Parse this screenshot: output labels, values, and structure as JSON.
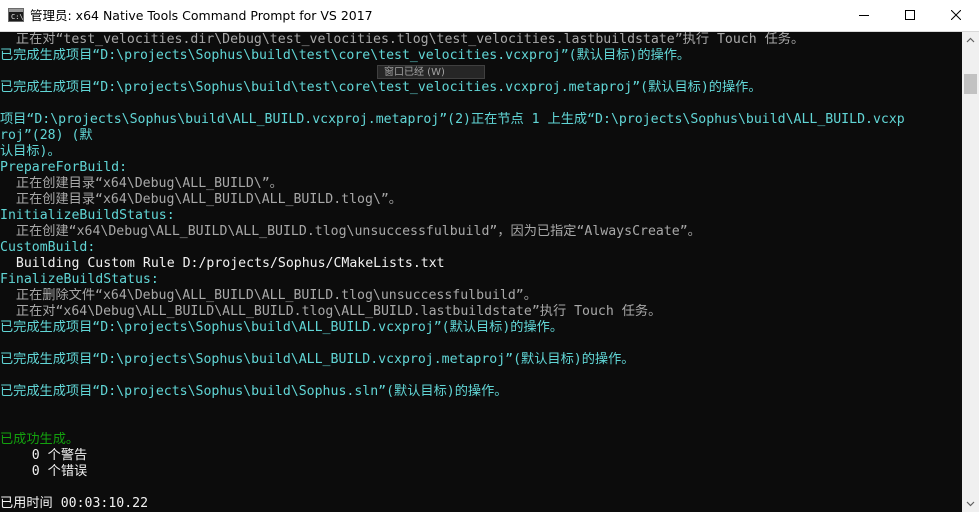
{
  "window": {
    "title": "管理员: x64 Native Tools Command Prompt for VS 2017",
    "icon_label": "C:\\"
  },
  "tooltip": {
    "text": "窗口已经 (W)"
  },
  "console": {
    "lines": [
      {
        "text": "  正在对“test_velocities.dir\\Debug\\test_velocities.tlog\\test_velocities.lastbuildstate”执行 Touch 任务。",
        "color": "gray"
      },
      {
        "text": "已完成生成项目“D:\\projects\\Sophus\\build\\test\\core\\test_velocities.vcxproj”(默认目标)的操作。",
        "color": "cyan"
      },
      {
        "text": "",
        "color": "gray"
      },
      {
        "text": "已完成生成项目“D:\\projects\\Sophus\\build\\test\\core\\test_velocities.vcxproj.metaproj”(默认目标)的操作。",
        "color": "cyan"
      },
      {
        "text": "",
        "color": "gray"
      },
      {
        "text": "项目“D:\\projects\\Sophus\\build\\ALL_BUILD.vcxproj.metaproj”(2)正在节点 1 上生成“D:\\projects\\Sophus\\build\\ALL_BUILD.vcxp",
        "color": "cyan"
      },
      {
        "text": "roj”(28) (默",
        "color": "cyan"
      },
      {
        "text": "认目标)。",
        "color": "cyan"
      },
      {
        "text": "PrepareForBuild:",
        "color": "cyan"
      },
      {
        "text": "  正在创建目录“x64\\Debug\\ALL_BUILD\\”。",
        "color": "gray"
      },
      {
        "text": "  正在创建目录“x64\\Debug\\ALL_BUILD\\ALL_BUILD.tlog\\”。",
        "color": "gray"
      },
      {
        "text": "InitializeBuildStatus:",
        "color": "cyan"
      },
      {
        "text": "  正在创建“x64\\Debug\\ALL_BUILD\\ALL_BUILD.tlog\\unsuccessfulbuild”，因为已指定“AlwaysCreate”。",
        "color": "gray"
      },
      {
        "text": "CustomBuild:",
        "color": "cyan"
      },
      {
        "text": "  Building Custom Rule D:/projects/Sophus/CMakeLists.txt",
        "color": "white"
      },
      {
        "text": "FinalizeBuildStatus:",
        "color": "cyan"
      },
      {
        "text": "  正在删除文件“x64\\Debug\\ALL_BUILD\\ALL_BUILD.tlog\\unsuccessfulbuild”。",
        "color": "gray"
      },
      {
        "text": "  正在对“x64\\Debug\\ALL_BUILD\\ALL_BUILD.tlog\\ALL_BUILD.lastbuildstate”执行 Touch 任务。",
        "color": "gray"
      },
      {
        "text": "已完成生成项目“D:\\projects\\Sophus\\build\\ALL_BUILD.vcxproj”(默认目标)的操作。",
        "color": "cyan"
      },
      {
        "text": "",
        "color": "gray"
      },
      {
        "text": "已完成生成项目“D:\\projects\\Sophus\\build\\ALL_BUILD.vcxproj.metaproj”(默认目标)的操作。",
        "color": "cyan"
      },
      {
        "text": "",
        "color": "gray"
      },
      {
        "text": "已完成生成项目“D:\\projects\\Sophus\\build\\Sophus.sln”(默认目标)的操作。",
        "color": "cyan"
      },
      {
        "text": "",
        "color": "gray"
      },
      {
        "text": "",
        "color": "gray"
      },
      {
        "text": "已成功生成。",
        "color": "green"
      },
      {
        "text": "    0 个警告",
        "color": "white"
      },
      {
        "text": "    0 个错误",
        "color": "white"
      },
      {
        "text": "",
        "color": "gray"
      },
      {
        "text": "已用时间 00:03:10.22",
        "color": "white"
      }
    ]
  },
  "colors": {
    "background": "#0c0c0c",
    "cyan": "#61d6d6",
    "gray": "#a8a8a8",
    "white": "#f2f2f2",
    "green": "#13a10e"
  },
  "icons": {
    "minimize": "minimize-icon",
    "maximize": "maximize-icon",
    "close": "close-icon",
    "scroll_up": "chevron-up-icon",
    "scroll_down": "chevron-down-icon"
  }
}
